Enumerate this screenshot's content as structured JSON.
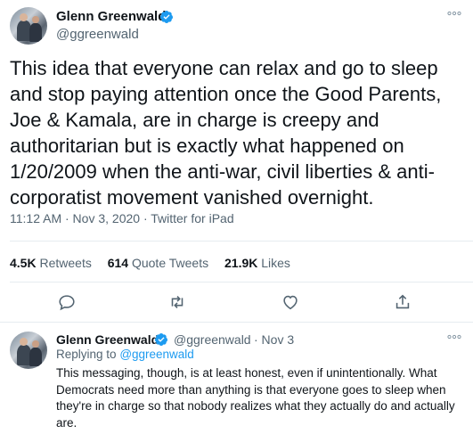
{
  "main_tweet": {
    "author_name": "Glenn Greenwald",
    "author_handle": "@ggreenwald",
    "text": "This idea that everyone can relax and go to sleep and stop paying attention once the Good Parents, Joe & Kamala, are in charge is creepy and authoritarian but is exactly what happened on 1/20/2009 when the anti-war, civil liberties & anti-corporatist movement vanished overnight.",
    "meta": "11:12 AM · Nov 3, 2020 · Twitter for iPad",
    "stats": {
      "retweets_count": "4.5K",
      "retweets_label": "Retweets",
      "quotes_count": "614",
      "quotes_label": "Quote Tweets",
      "likes_count": "21.9K",
      "likes_label": "Likes"
    },
    "more_icon": "ellipsis-icon"
  },
  "reply_tweet": {
    "author_name": "Glenn Greenwald",
    "author_handle": "@ggreenwald",
    "date": "· Nov 3",
    "replying_prefix": "Replying to",
    "replying_handle": "@ggreenwald",
    "text": "This messaging, though, is at least honest, even if unintentionally. What Democrats need more than anything is that everyone goes to sleep when they're in charge so that nobody realizes what they actually do and actually are."
  },
  "colors": {
    "accent": "#1d9bf0",
    "secondary_text": "#536471",
    "divider": "#e6ecf0"
  },
  "icons": [
    "reply-icon",
    "retweet-icon",
    "like-icon",
    "share-icon",
    "verified-badge-icon"
  ]
}
